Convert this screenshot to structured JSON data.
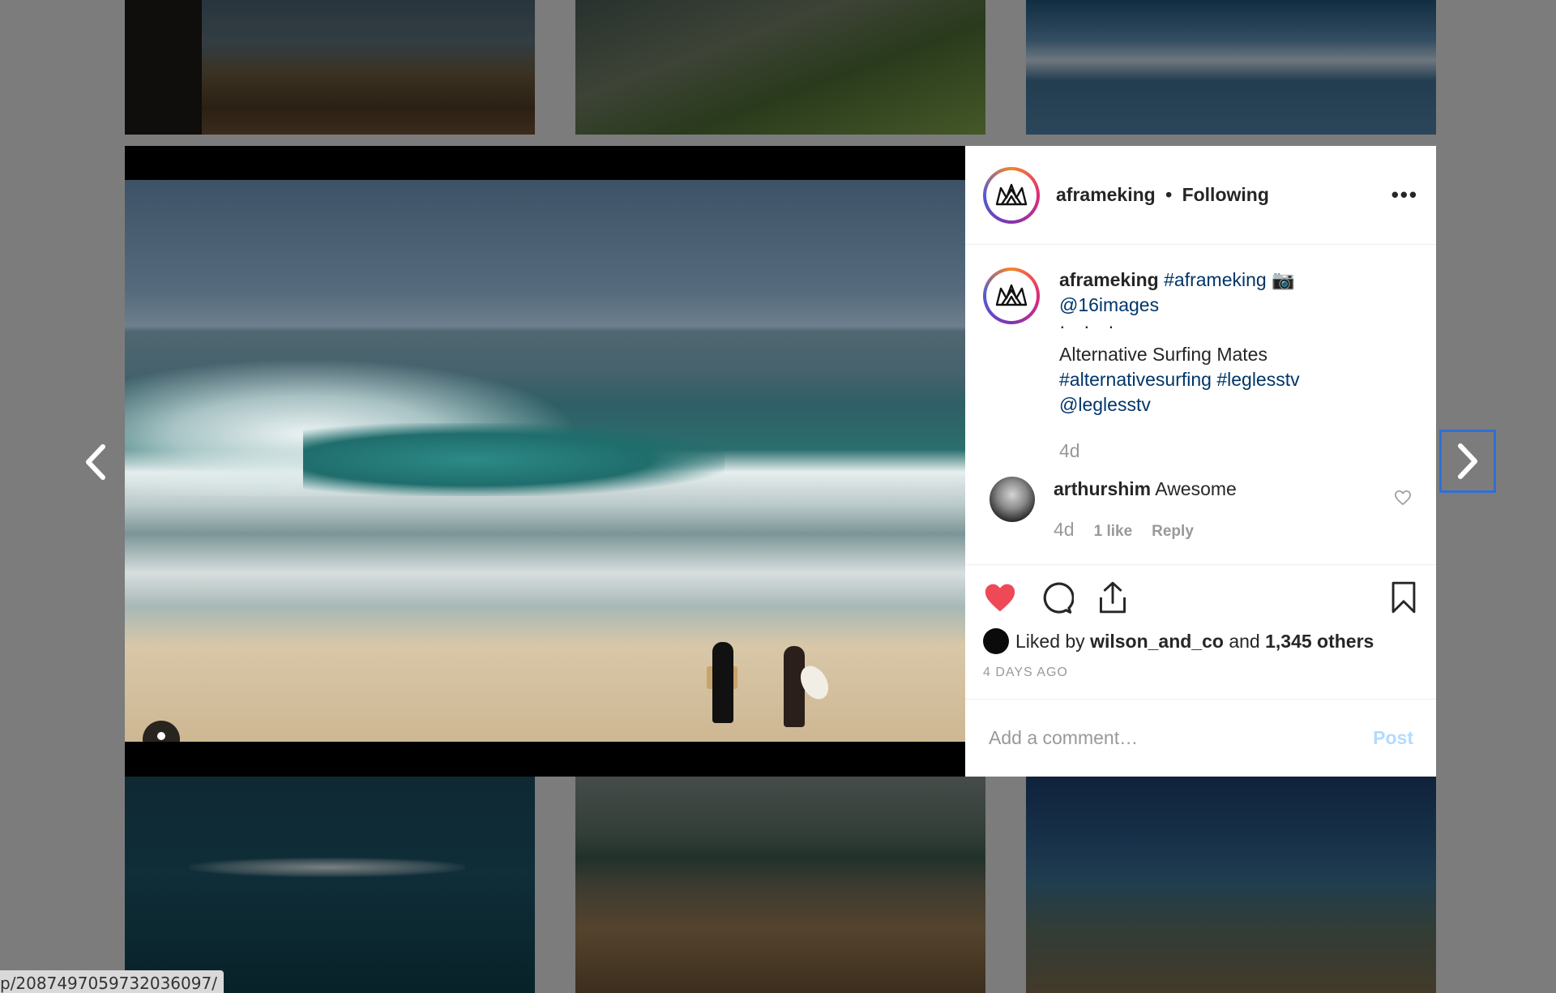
{
  "colors": {
    "like_heart": "#ed4956",
    "link": "#003569",
    "muted": "#999999",
    "post_disabled": "#b3dbff",
    "focus_ring": "#2f6fd8"
  },
  "post": {
    "header": {
      "username": "aframeking",
      "separator": "•",
      "follow_status": "Following",
      "more_label": "•••"
    },
    "caption": {
      "username": "aframeking",
      "hashtag_1": "#aframeking",
      "camera_emoji": "📷",
      "mention_1": "@16images",
      "dots": "· · ·",
      "text": "Alternative Surfing Mates",
      "hashtags_line": "#alternativesurfing #leglesstv",
      "mention_2": "@leglesstv",
      "time": "4d"
    },
    "comment": {
      "username": "arthurshim",
      "text": "Awesome",
      "time": "4d",
      "likes": "1 like",
      "reply_label": "Reply"
    },
    "likes": {
      "prefix": "Liked by",
      "user": "wilson_and_co",
      "conj": "and",
      "others": "1,345 others"
    },
    "date": "4 DAYS AGO",
    "add_comment": {
      "placeholder": "Add a comment…",
      "post_label": "Post"
    },
    "icons": {
      "like": "heart-icon",
      "comment": "comment-icon",
      "share": "share-icon",
      "save": "bookmark-icon",
      "tag": "user-tag-icon"
    }
  },
  "navigation": {
    "prev": "chevron-left-icon",
    "next": "chevron-right-icon"
  },
  "status_bar": {
    "url": "p/2087497059732036097/"
  }
}
